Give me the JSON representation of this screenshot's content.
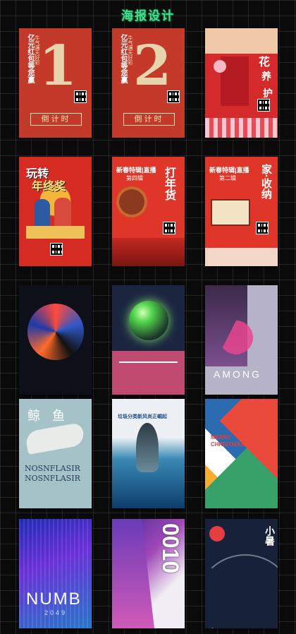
{
  "page": {
    "title": "海报设计"
  },
  "posters": {
    "p1": {
      "vertical": "亿元红包等您赢",
      "side": "牛气满天好彩",
      "number": "1",
      "button": "倒计时"
    },
    "p2": {
      "vertical": "亿元红包等您赢",
      "side": "牛气满天好彩",
      "number": "2",
      "button": "倒计时"
    },
    "p3": {
      "chars": [
        "花",
        "养",
        "护"
      ]
    },
    "p4": {
      "line1": "玩转",
      "line2": "年终奖"
    },
    "p5": {
      "header": "新春特辑|直播",
      "issue": "第四辑",
      "big": "打年货"
    },
    "p6": {
      "header": "新春特辑|直播",
      "issue": "第二辑",
      "big": "家·收纳"
    },
    "p7": {},
    "p8": {},
    "p9": {
      "word": "AMONG"
    },
    "p10": {
      "chars": "鲸 鱼",
      "word1": "NOSNFLASIR",
      "word2": "NOSNFLASIR"
    },
    "p11": {
      "headline": "垃圾分类新风尚正崛起"
    },
    "p12": {
      "line1": "MERRY",
      "line2": "CHRISTMAS"
    },
    "p13": {
      "word": "NUMB",
      "year": "2049"
    },
    "p14": {
      "number": "0010"
    },
    "p15": {
      "title": "小暑"
    }
  }
}
